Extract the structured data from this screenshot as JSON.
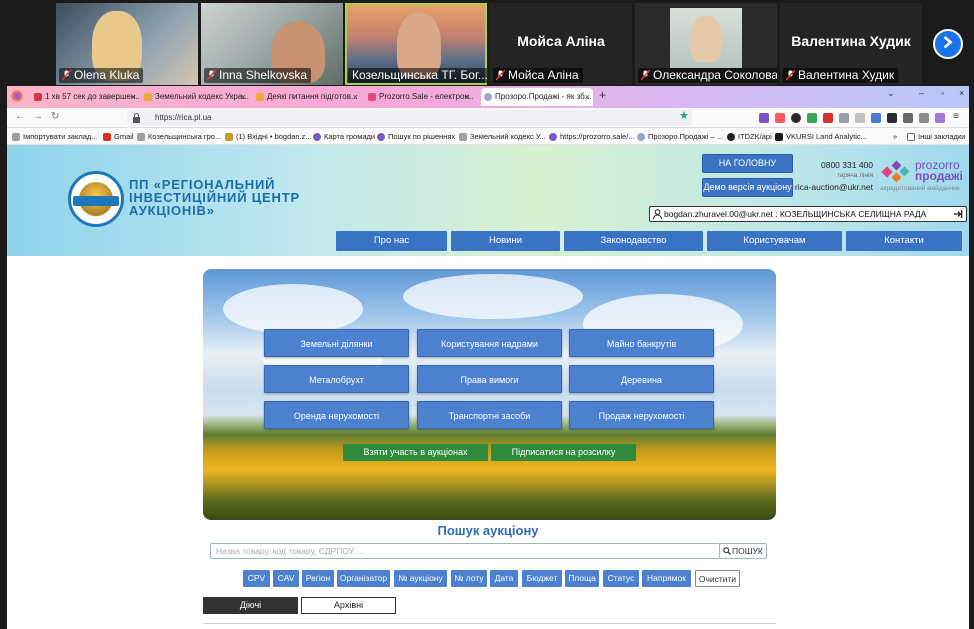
{
  "participants": [
    {
      "name": "Olena Kluka"
    },
    {
      "name": "Inna Shelkovska"
    },
    {
      "name": "Козельщинська ТГ. Бог..."
    },
    {
      "name": "Мойса Аліна",
      "big": "Мойса Аліна"
    },
    {
      "name": "Олександра Соколова"
    },
    {
      "name": "Валентина Худик",
      "big": "Валентина Худик"
    }
  ],
  "browser": {
    "tabs": [
      {
        "label": "1 хв 57 сек до завершен..."
      },
      {
        "label": "Земельний кодекс Укра..."
      },
      {
        "label": "Деякі питання підготов..."
      },
      {
        "label": "Prozorro.Sale - електрон..."
      },
      {
        "label": "Прозоро.Продажі - як зб..."
      }
    ],
    "url": "https://rica.pl.ua",
    "bookmarks": [
      "Імпортувати заклад...",
      "Gmail",
      "Козельщинська гро...",
      "(1) Вхідні • bogdan.z...",
      "Карта громади",
      "Пошук по рішеннях",
      "Земельний кодекс У...",
      "https://prozorro.sale/...",
      "Прозоро.Продажі – ...",
      "ITDZK/api",
      "VKURSI Land Analytic...",
      "Інші закладки"
    ]
  },
  "site": {
    "org_name": "ПП «РЕГІОНАЛЬНИЙ ІНВЕСТИЦІЙНИЙ ЦЕНТР АУКЦІОНІВ»",
    "logo_text": "ЦЕНТР АУКЦІОНІВ",
    "home_btn": "НА ГОЛОВНУ",
    "demo_btn": "Демо версія аукціону",
    "phone": "0800 331 400",
    "hotline": "гаряча лінія",
    "email": "rica-auction@ukr.net",
    "pz1": "prozorro",
    "pz2": "продажі",
    "accredited": "акредитований майданчик",
    "user": "bogdan.zhuravel.00@ukr.net : КОЗЕЛЬЩИНСЬКА СЕЛИЩНА РАДА",
    "menu": [
      "Про нас",
      "Новини",
      "Законодавство",
      "Користувачам",
      "Контакти"
    ],
    "categories": [
      "Земельні ділянки",
      "Користування надрами",
      "Майно банкрутів",
      "Металобрухт",
      "Права вимоги",
      "Деревина",
      "Оренда нерухомості",
      "Транспортні засоби",
      "Продаж нерухомості"
    ],
    "cta": [
      "Взяти участь в аукціонах",
      "Підписатися на розсилку"
    ],
    "search_title": "Пошук аукціону",
    "search_placeholder": "Назва товару, код товару, ЄДРПОУ ...",
    "search_btn": "ПОШУК",
    "filters": [
      "CPV",
      "CAV",
      "Регіон",
      "Організатор",
      "№ аукціону",
      "№ лоту",
      "Дата",
      "Бюджет",
      "Площа",
      "Статус",
      "Напрямок"
    ],
    "clear": "Очистити",
    "toggle_on": "Діючі",
    "toggle_off": "Архівні"
  },
  "colors": {
    "accent": "#3a73c4",
    "green": "#2e8b3e",
    "title": "#1a6faa"
  }
}
